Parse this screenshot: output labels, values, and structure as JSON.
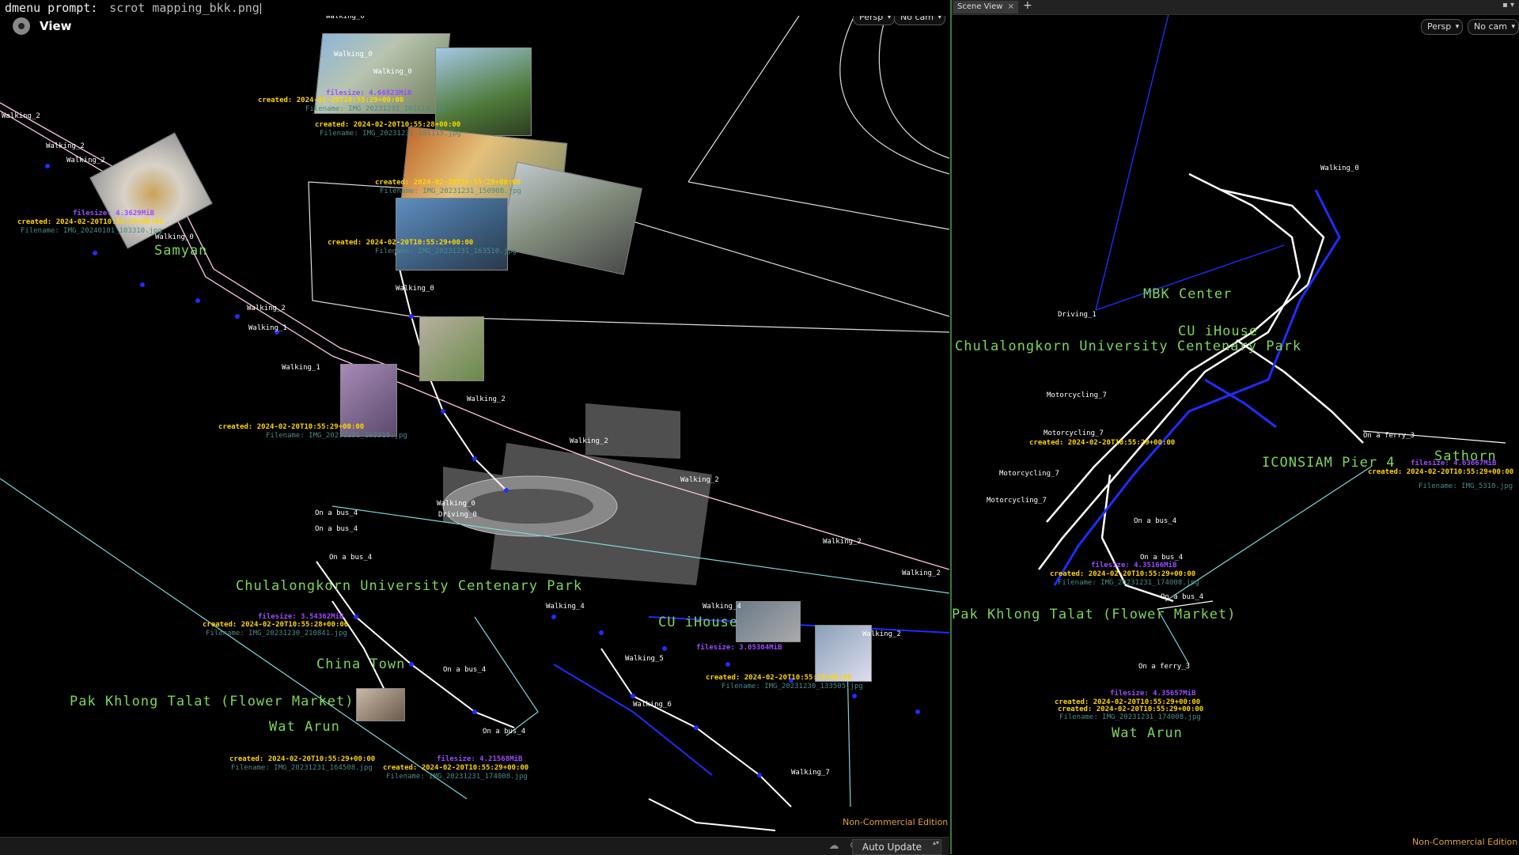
{
  "dmenu": {
    "prompt": "dmenu prompt:",
    "input": "scrot mapping_bkk.png"
  },
  "left_view": {
    "title": "View",
    "toolbar": {
      "persp": "Persp",
      "cam": "No cam"
    },
    "watermark": "Non-Commercial Edition",
    "status": {
      "auto_update": "Auto Update"
    },
    "places": {
      "samyan": "Samyan",
      "chula": "Chulalongkorn University Centenary Park",
      "cuihouse": "CU iHouse",
      "chinatown": "China Town",
      "pakkhlong": "Pak Khlong Talat (Flower Market)",
      "watarun": "Wat Arun"
    },
    "photo_meta": {
      "m1_filesize": "filesize: 4.66823MiB",
      "m1_created": "created: 2024-02-20T10:55:29+00:00",
      "m1_filename": "Filename: IMG_20231231_101115.jpg",
      "m2_created": "created: 2024-02-20T10:55:28+00:00",
      "m2_filename": "Filename: IMG_20231231_101115.jpg",
      "m3_filesize": "filesize: 4.3629MiB",
      "m3_created": "created: 2024-02-20T10:55:29+00:00",
      "m3_filename": "Filename: IMG_20240101_103310.jpg",
      "m4_created": "created: 2024-02-20T10:55:29+00:00",
      "m4_filename": "Filename: IMG_20231231_150908.jpg",
      "m5_created": "created: 2024-02-20T10:55:29+00:00",
      "m5_filename": "Filename: IMG_20231231_163510.jpg",
      "m6_created": "created: 2024-02-20T10:55:29+00:00",
      "m6_filename": "Filename: IMG_20231231_103310.jpg",
      "m7_filesize": "filesize: 3.54362MiB",
      "m7_created": "created: 2024-02-20T10:55:28+00:00",
      "m7_filename": "Filename: IMG_20231230_210841.jpg",
      "m8_filesize": "filesize: 4.21568MiB",
      "m8_created": "created: 2024-02-20T10:55:29+00:00",
      "m8_filename": "Filename: IMG_20231231_174008.jpg",
      "m9_filesize": "filesize: 3.05304MiB",
      "m9_created": "created: 2024-02-20T10:55:28+00:00",
      "m9_filename": "Filename: IMG_20231230_133505.jpg",
      "m10_created": "created: 2024-02-20T10:55:29+00:00",
      "m10_filename": "Filename: IMG_20231231_164508.jpg"
    },
    "track_labels": {
      "walking0": "Walking_0",
      "walking1": "Walking_1",
      "walking2": "Walking_2",
      "walking4": "Walking_4",
      "walking5": "Walking_5",
      "walking6": "Walking_6",
      "walking7": "Walking_7",
      "driving0": "Driving_0",
      "bus4": "On a bus_4"
    }
  },
  "right_view": {
    "tab": "Scene View",
    "toolbar": {
      "persp": "Persp",
      "cam": "No cam"
    },
    "watermark": "Non-Commercial Edition",
    "places": {
      "mbk": "MBK Center",
      "cuihouse": "CU iHouse",
      "chula": "Chulalongkorn University Centenary Park",
      "iconsiam": "ICONSIAM Pier 4",
      "sathorn": "Sathorn",
      "pakkhlong": "Pak Khlong Talat (Flower Market)",
      "watarun": "Wat Arun"
    },
    "track_labels": {
      "driving1": "Driving_1",
      "motorcycling7": "Motorcycling_7",
      "bus4": "On a bus_4",
      "ferry3": "On a ferry_3",
      "walking0": "Walking_0"
    },
    "photo_meta": {
      "r1_filesize": "filesize: 4.35166MiB",
      "r1_created": "created: 2024-02-20T10:55:29+00:00",
      "r1_filename": "Filename: IMG_20231231_174008.jpg",
      "r2_filesize": "filesize: 4.63667MiB",
      "r2_created": "created: 2024-02-20T10:55:29+00:00",
      "r2_filename": "Filename: IMG_5310.jpg",
      "r3_created": "created: 2024-02-20T10:55:29+00:00",
      "r4_filesize": "filesize: 4.35657MiB",
      "r4_created": "created: 2024-02-20T10:55:29+00:00",
      "r4_created2": "created: 2024-02-20T10:55:29+00:00",
      "r4_filename": "Filename: IMG_20231231_174008.jpg"
    }
  },
  "colors": {
    "track_white": "#ffffff",
    "track_blue": "#1f2dff",
    "place_green": "#7dd65a",
    "created_yellow": "#ffd400",
    "filesize_purple": "#9b4dff",
    "cyan_line": "#7fd6d6",
    "border_green": "#3a7a3a"
  }
}
